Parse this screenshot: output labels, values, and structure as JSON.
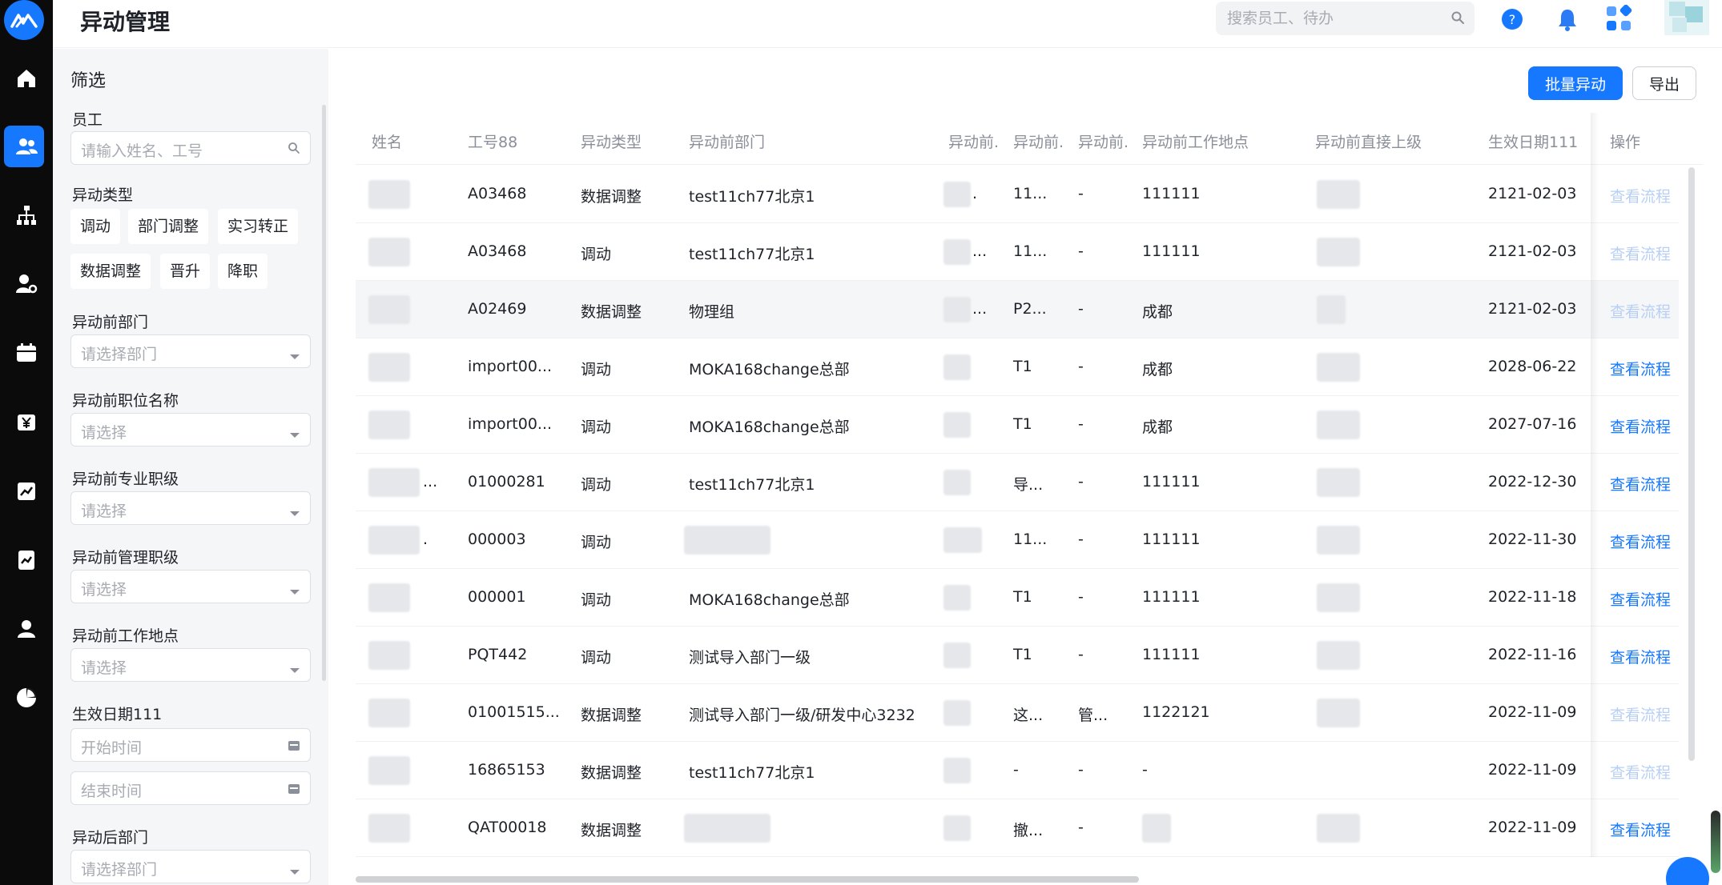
{
  "header": {
    "title": "异动管理",
    "search_placeholder": "搜索员工、待办"
  },
  "rail": {
    "items": [
      "home-icon",
      "users-icon",
      "org-chart-icon",
      "user-settings-icon",
      "calendar-icon",
      "yen-icon",
      "chart-trend-icon",
      "report-icon",
      "person-icon",
      "pie-chart-icon"
    ],
    "active_index": 1,
    "accent": "#1677ff"
  },
  "filters": {
    "title": "筛选",
    "employee_label": "员工",
    "employee_placeholder": "请输入姓名、工号",
    "type_label": "异动类型",
    "type_chips": [
      "调动",
      "部门调整",
      "实习转正",
      "数据调整",
      "晋升",
      "降职"
    ],
    "dept_before_label": "异动前部门",
    "dept_placeholder": "请选择部门",
    "position_before_label": "异动前职位名称",
    "select_placeholder": "请选择",
    "pro_grade_before_label": "异动前专业职级",
    "mgmt_grade_before_label": "异动前管理职级",
    "location_before_label": "异动前工作地点",
    "effective_date_label": "生效日期111",
    "start_placeholder": "开始时间",
    "end_placeholder": "结束时间",
    "dept_after_label": "异动后部门"
  },
  "actions": {
    "batch": "批量异动",
    "export": "导出"
  },
  "table": {
    "columns": [
      "姓名",
      "工号88",
      "异动类型",
      "异动前部门",
      "异动前.",
      "异动前.",
      "异动前.",
      "异动前工作地点",
      "异动前直接上级",
      "生效日期111",
      "操作"
    ],
    "rows": [
      {
        "name": "",
        "id": "A03468",
        "type": "数据调整",
        "dept": "test11ch77北京1",
        "c1": ".",
        "c2": "11...",
        "c3": "-",
        "loc": "111111",
        "date": "2121-02-03",
        "action": "查看流程",
        "enabled": false
      },
      {
        "name": "",
        "id": "A03468",
        "type": "调动",
        "dept": "test11ch77北京1",
        "c1": "...",
        "c2": "11...",
        "c3": "-",
        "loc": "111111",
        "date": "2121-02-03",
        "action": "查看流程",
        "enabled": false
      },
      {
        "name": "",
        "id": "A02469",
        "type": "数据调整",
        "dept": "物理组",
        "c1": "...",
        "c2": "P2...",
        "c3": "-",
        "loc": "成都",
        "date": "2121-02-03",
        "action": "查看流程",
        "enabled": false
      },
      {
        "name": "",
        "id": "import00...",
        "type": "调动",
        "dept": "MOKA168change总部",
        "c1": "",
        "c2": "T1",
        "c3": "-",
        "loc": "成都",
        "date": "2028-06-22",
        "action": "查看流程",
        "enabled": true
      },
      {
        "name": "",
        "id": "import00...",
        "type": "调动",
        "dept": "MOKA168change总部",
        "c1": "",
        "c2": "T1",
        "c3": "-",
        "loc": "成都",
        "date": "2027-07-16",
        "action": "查看流程",
        "enabled": true
      },
      {
        "name": "...",
        "id": "01000281",
        "type": "调动",
        "dept": "test11ch77北京1",
        "c1": "",
        "c2": "导...",
        "c3": "-",
        "loc": "111111",
        "date": "2022-12-30",
        "action": "查看流程",
        "enabled": true
      },
      {
        "name": ".",
        "id": "000003",
        "type": "调动",
        "dept": "",
        "c1": "",
        "c2": "11...",
        "c3": "-",
        "loc": "111111",
        "date": "2022-11-30",
        "action": "查看流程",
        "enabled": true
      },
      {
        "name": "",
        "id": "000001",
        "type": "调动",
        "dept": "MOKA168change总部",
        "c1": "",
        "c2": "T1",
        "c3": "-",
        "loc": "111111",
        "date": "2022-11-18",
        "action": "查看流程",
        "enabled": true
      },
      {
        "name": "",
        "id": "PQT442",
        "type": "调动",
        "dept": "测试导入部门一级",
        "c1": "",
        "c2": "T1",
        "c3": "-",
        "loc": "111111",
        "date": "2022-11-16",
        "action": "查看流程",
        "enabled": true
      },
      {
        "name": "",
        "id": "01001515...",
        "type": "数据调整",
        "dept": "测试导入部门一级/研发中心3232",
        "c1": "",
        "c2": "这...",
        "c3": "管...",
        "loc": "1122121",
        "date": "2022-11-09",
        "action": "查看流程",
        "enabled": false
      },
      {
        "name": "",
        "id": "16865153",
        "type": "数据调整",
        "dept": "test11ch77北京1",
        "c1": "",
        "c2": "-",
        "c3": "-",
        "loc": "-",
        "date": "2022-11-09",
        "action": "查看流程",
        "enabled": false
      },
      {
        "name": "",
        "id": "QAT00018",
        "type": "数据调整",
        "dept": "",
        "c1": "",
        "c2": "撤...",
        "c3": "-",
        "loc": "",
        "date": "2022-11-09",
        "action": "查看流程",
        "enabled": true
      }
    ]
  }
}
